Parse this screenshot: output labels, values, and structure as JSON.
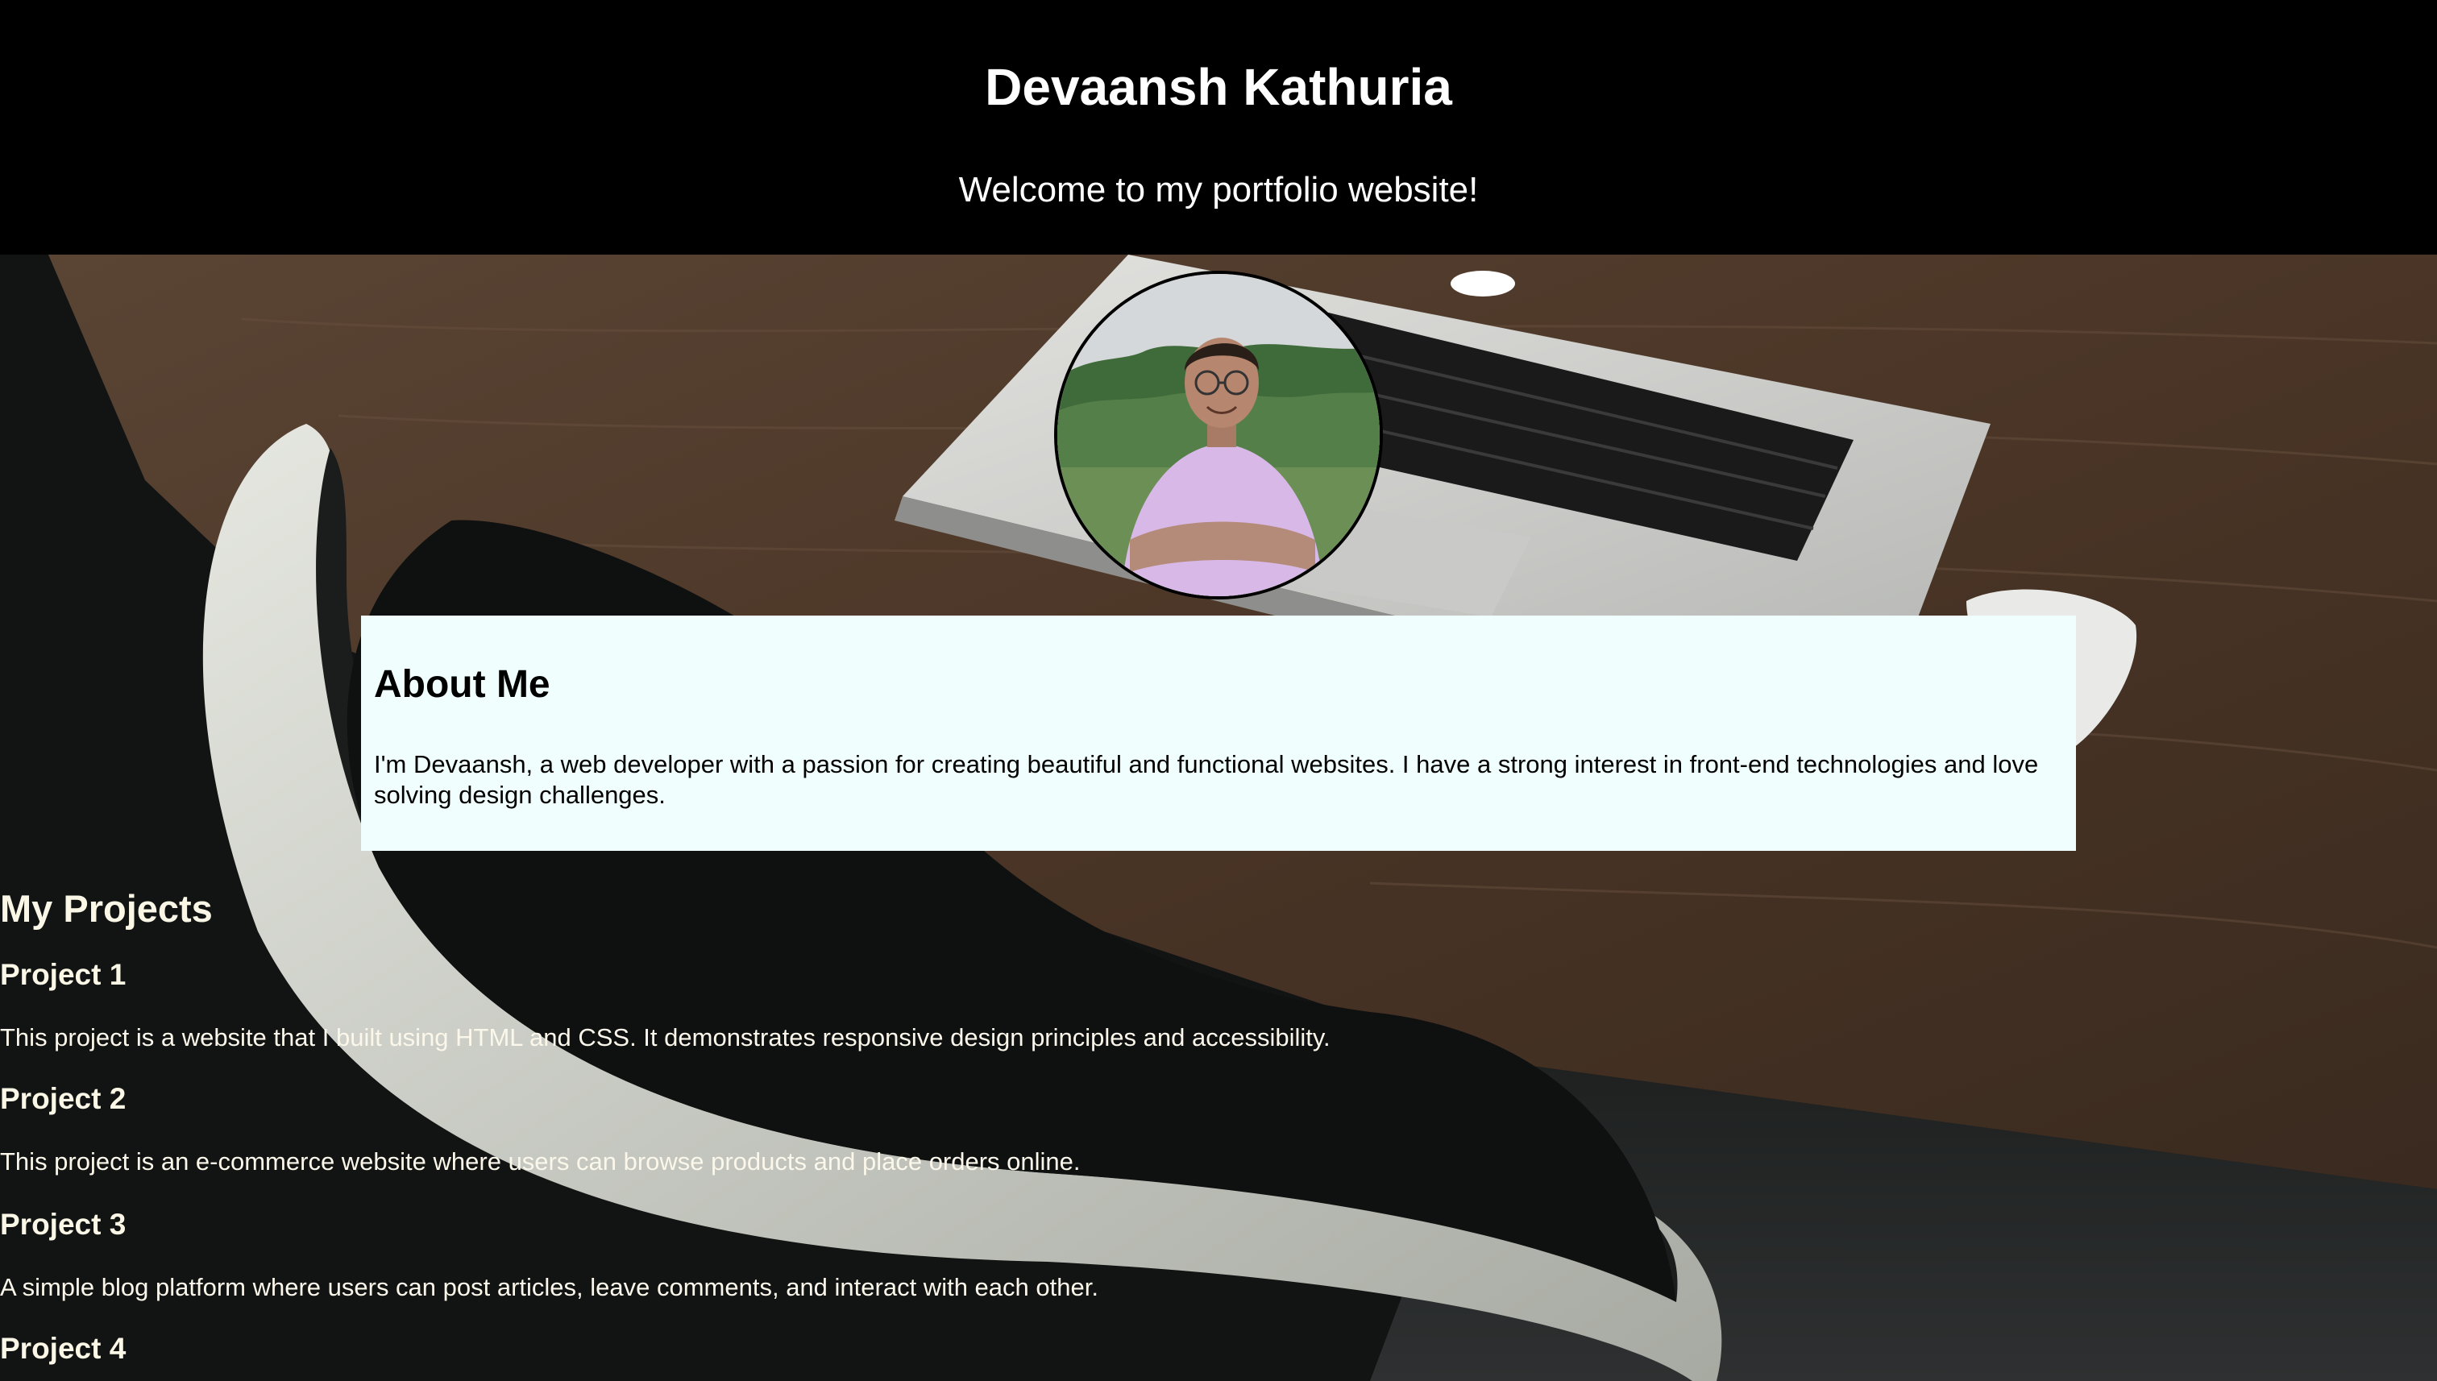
{
  "header": {
    "title": "Devaansh Kathuria",
    "tagline": "Welcome to my portfolio website!"
  },
  "about": {
    "title": "About Me",
    "text": "I'm Devaansh, a web developer with a passion for creating beautiful and functional websites. I have a strong interest in front-end technologies and love solving design challenges."
  },
  "projects": {
    "title": "My Projects",
    "items": [
      {
        "name": "Project 1",
        "description": "This project is a website that I built using HTML and CSS. It demonstrates responsive design principles and accessibility."
      },
      {
        "name": "Project 2",
        "description": "This project is an e-commerce website where users can browse products and place orders online."
      },
      {
        "name": "Project 3",
        "description": "A simple blog platform where users can post articles, leave comments, and interact with each other."
      },
      {
        "name": "Project 4",
        "description": ""
      }
    ]
  },
  "colors": {
    "header_bg": "#000000",
    "about_bg": "#f0fffe",
    "projects_text": "#fbf7e6"
  }
}
